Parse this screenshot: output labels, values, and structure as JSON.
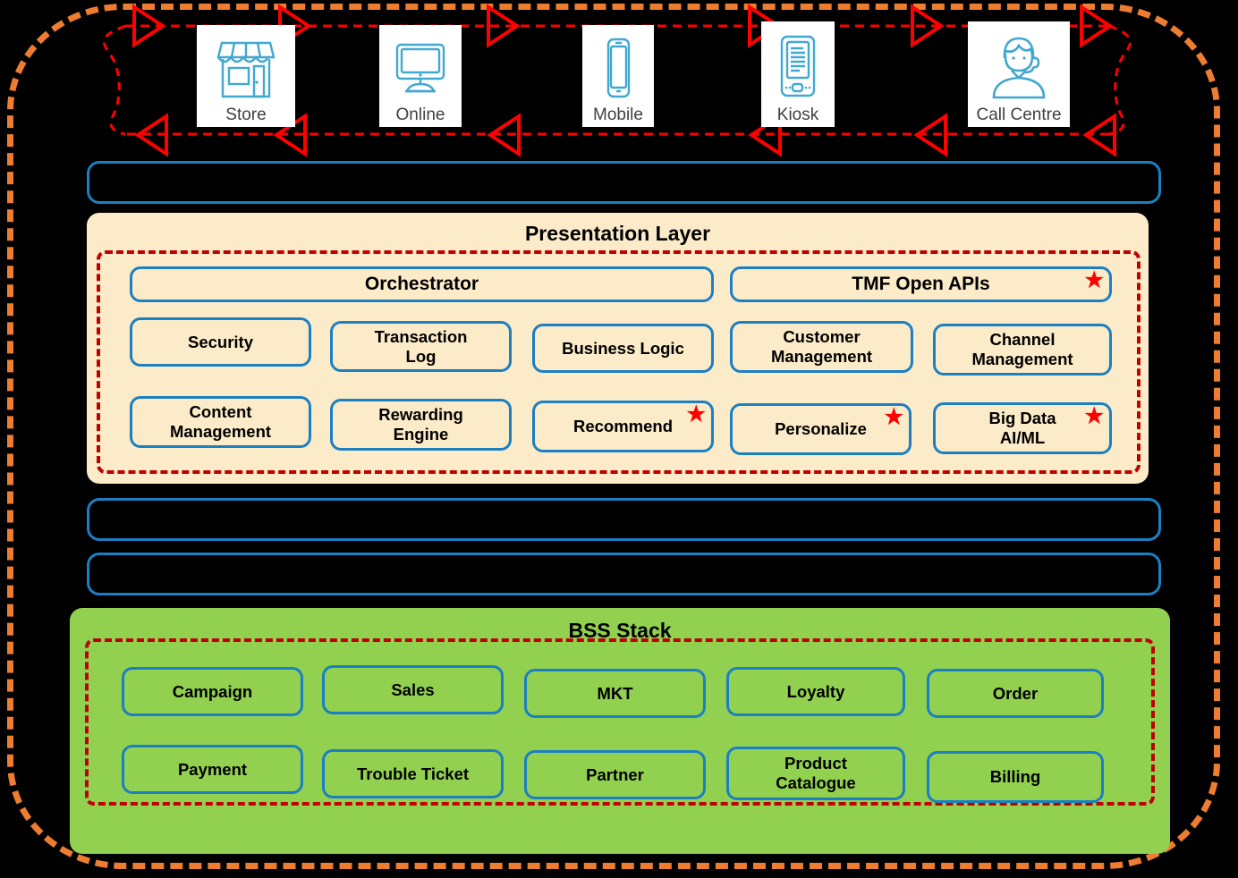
{
  "colors": {
    "background": "#000000",
    "outer_border": "#ED7D31",
    "box_border": "#1B7FC3",
    "group_dashed": "#C00000",
    "presentation_fill": "#FCEBC8",
    "bss_fill": "#92D050",
    "star": "#FF0000",
    "arrow": "#FF0000"
  },
  "channels": [
    {
      "label": "Store",
      "icon": "storefront-icon"
    },
    {
      "label": "Online",
      "icon": "desktop-monitor-icon"
    },
    {
      "label": "Mobile",
      "icon": "smartphone-icon"
    },
    {
      "label": "Kiosk",
      "icon": "tablet-kiosk-icon"
    },
    {
      "label": "Call Centre",
      "icon": "headset-agent-icon"
    }
  ],
  "presentation_layer": {
    "title": "Presentation Layer",
    "top_row": [
      {
        "label": "Orchestrator",
        "starred": false
      },
      {
        "label": "TMF Open APIs",
        "starred": true
      }
    ],
    "middle_row": [
      {
        "label": "Security",
        "starred": false
      },
      {
        "label": "Transaction\nLog",
        "starred": false
      },
      {
        "label": "Business Logic",
        "starred": false
      },
      {
        "label": "Customer\nManagement",
        "starred": false
      },
      {
        "label": "Channel\nManagement",
        "starred": false
      }
    ],
    "bottom_row": [
      {
        "label": "Content\nManagement",
        "starred": false
      },
      {
        "label": "Rewarding\nEngine",
        "starred": false
      },
      {
        "label": "Recommend",
        "starred": true
      },
      {
        "label": "Personalize",
        "starred": true
      },
      {
        "label": "Big Data\nAI/ML",
        "starred": true
      }
    ]
  },
  "bss_stack": {
    "title": "BSS Stack",
    "top_row": [
      {
        "label": "Campaign"
      },
      {
        "label": "Sales"
      },
      {
        "label": "MKT"
      },
      {
        "label": "Loyalty"
      },
      {
        "label": "Order"
      }
    ],
    "bottom_row": [
      {
        "label": "Payment"
      },
      {
        "label": "Trouble Ticket"
      },
      {
        "label": "Partner"
      },
      {
        "label": "Product\nCatalogue"
      },
      {
        "label": "Billing"
      }
    ]
  },
  "empty_bars": [
    {
      "name": "blue-bar-below-channels"
    },
    {
      "name": "blue-bar-below-presentation"
    },
    {
      "name": "blue-bar-above-bss"
    }
  ],
  "star_glyph": "★",
  "arrows": {
    "top_line_direction": "right",
    "bottom_line_direction": "left",
    "style": "dashed",
    "arrowhead": "open-triangle"
  }
}
